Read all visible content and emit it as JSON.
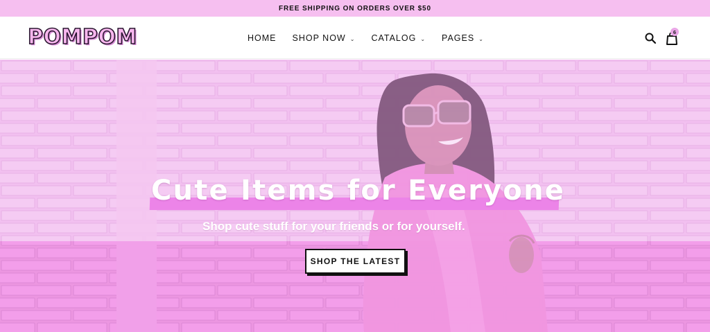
{
  "announcement": {
    "text": "FREE SHIPPING ON ORDERS OVER $50"
  },
  "header": {
    "logo": "POMPOM",
    "nav": [
      {
        "label": "HOME",
        "has_dropdown": false
      },
      {
        "label": "SHOP NOW",
        "has_dropdown": true
      },
      {
        "label": "CATALOG",
        "has_dropdown": true
      },
      {
        "label": "PAGES",
        "has_dropdown": true
      }
    ],
    "icons": {
      "search": "search-icon",
      "cart": "shopping-bag-icon",
      "dropdown": "chevron-down-icon"
    },
    "cart_count": "6"
  },
  "hero": {
    "title": "Cute Items for Everyone",
    "subtitle": "Shop cute stuff for your friends or for yourself.",
    "cta_label": "SHOP THE LATEST",
    "image": "woman-in-sunglasses-photo"
  },
  "colors": {
    "announcement_bg": "#f6bff0",
    "accent_pink": "#ec84e8",
    "hero_tint": "#f2c6f1",
    "text_dark": "#111111"
  }
}
